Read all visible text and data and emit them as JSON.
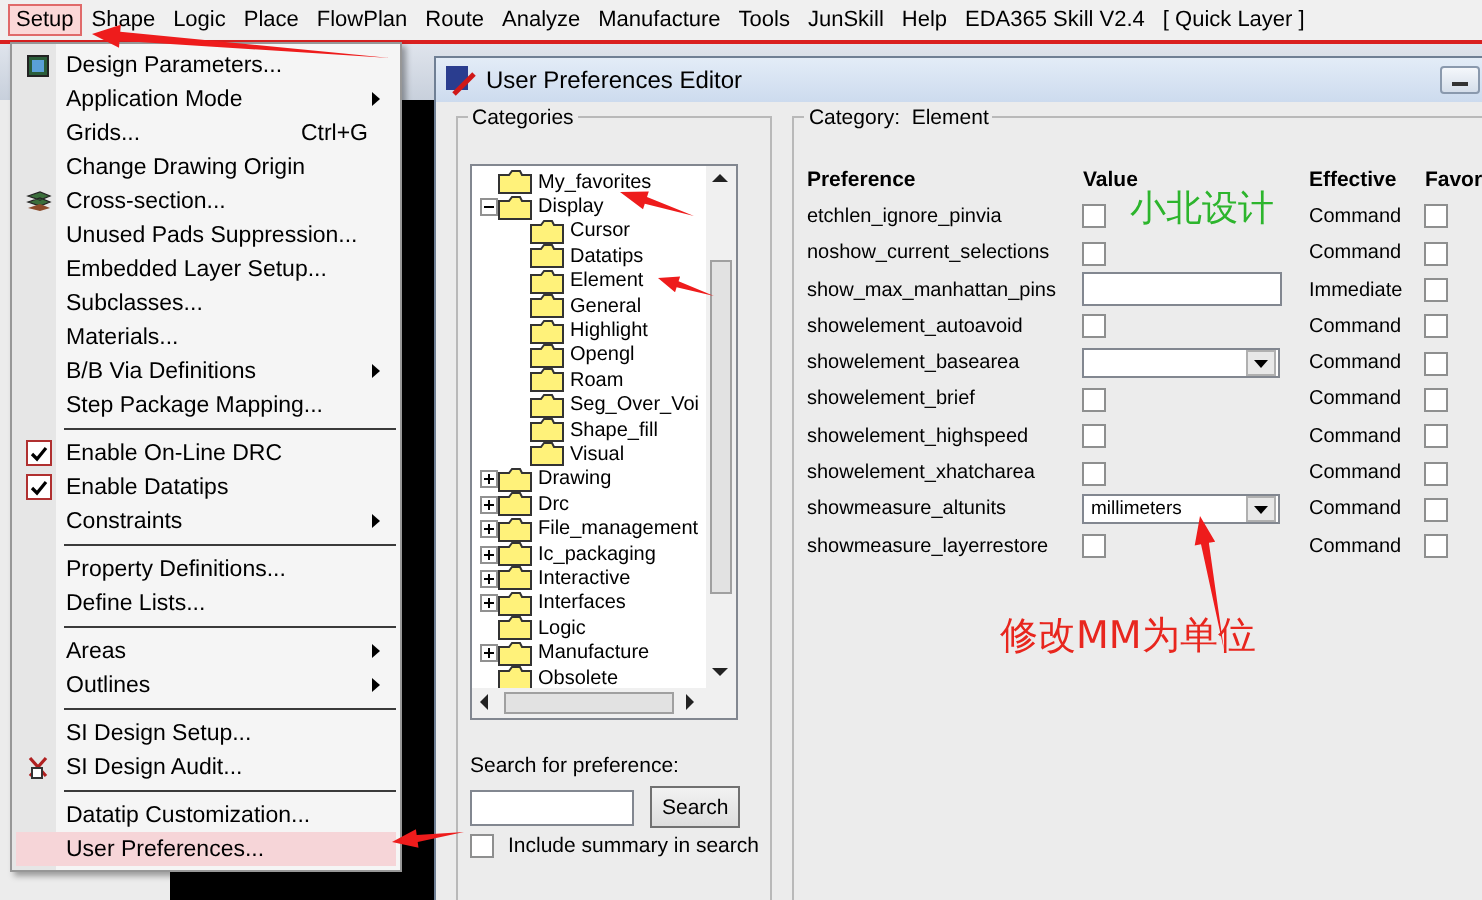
{
  "menu_bar": [
    {
      "label": "Setup",
      "selected": true
    },
    {
      "label": "Shape",
      "selected": false
    },
    {
      "label": "Logic",
      "selected": false
    },
    {
      "label": "Place",
      "selected": false
    },
    {
      "label": "FlowPlan",
      "selected": false
    },
    {
      "label": "Route",
      "selected": false
    },
    {
      "label": "Analyze",
      "selected": false
    },
    {
      "label": "Manufacture",
      "selected": false
    },
    {
      "label": "Tools",
      "selected": false
    },
    {
      "label": "JunSkill",
      "selected": false
    },
    {
      "label": "Help",
      "selected": false
    },
    {
      "label": "EDA365 Skill V2.4",
      "selected": false
    },
    {
      "label": "[ Quick Layer ]",
      "selected": false
    }
  ],
  "setup_menu": [
    {
      "kind": "item",
      "label": "Design Parameters...",
      "selected": false
    },
    {
      "kind": "item",
      "label": "Application Mode",
      "submenu": true,
      "selected": false
    },
    {
      "kind": "item",
      "label": "Grids...",
      "shortcut": "Ctrl+G",
      "selected": false
    },
    {
      "kind": "item",
      "label": "Change Drawing Origin",
      "selected": false
    },
    {
      "kind": "item",
      "label": "Cross-section...",
      "selected": false
    },
    {
      "kind": "item",
      "label": "Unused Pads Suppression...",
      "selected": false
    },
    {
      "kind": "item",
      "label": "Embedded Layer Setup...",
      "selected": false
    },
    {
      "kind": "item",
      "label": "Subclasses...",
      "selected": false
    },
    {
      "kind": "item",
      "label": "Materials...",
      "selected": false
    },
    {
      "kind": "item",
      "label": "B/B Via Definitions",
      "submenu": true,
      "selected": false
    },
    {
      "kind": "item",
      "label": "Step Package Mapping...",
      "selected": false
    },
    {
      "kind": "separator"
    },
    {
      "kind": "check",
      "label": "Enable On-Line DRC",
      "checked": true,
      "selected": false
    },
    {
      "kind": "check",
      "label": "Enable Datatips",
      "checked": true,
      "selected": false
    },
    {
      "kind": "item",
      "label": "Constraints",
      "submenu": true,
      "selected": false
    },
    {
      "kind": "separator"
    },
    {
      "kind": "item",
      "label": "Property Definitions...",
      "selected": false
    },
    {
      "kind": "item",
      "label": "Define Lists...",
      "selected": false
    },
    {
      "kind": "separator"
    },
    {
      "kind": "item",
      "label": "Areas",
      "submenu": true,
      "selected": false
    },
    {
      "kind": "item",
      "label": "Outlines",
      "submenu": true,
      "selected": false
    },
    {
      "kind": "separator"
    },
    {
      "kind": "item",
      "label": "SI Design Setup...",
      "selected": false
    },
    {
      "kind": "item",
      "label": "SI Design Audit...",
      "selected": false
    },
    {
      "kind": "separator"
    },
    {
      "kind": "item",
      "label": "Datatip Customization...",
      "selected": false
    },
    {
      "kind": "item",
      "label": "User Preferences...",
      "selected": true
    }
  ],
  "dialog": {
    "title": "User Preferences Editor",
    "categories": {
      "title": "Categories",
      "tree": [
        {
          "label": "My_favorites"
        },
        {
          "label": "Display",
          "expanded": true,
          "children": [
            {
              "label": "Cursor"
            },
            {
              "label": "Datatips"
            },
            {
              "label": "Element"
            },
            {
              "label": "General"
            },
            {
              "label": "Highlight"
            },
            {
              "label": "Opengl"
            },
            {
              "label": "Roam"
            },
            {
              "label": "Seg_Over_Voi"
            },
            {
              "label": "Shape_fill"
            },
            {
              "label": "Visual"
            }
          ]
        },
        {
          "label": "Drawing",
          "expanded": false
        },
        {
          "label": "Drc",
          "expanded": false
        },
        {
          "label": "File_management",
          "expanded": false
        },
        {
          "label": "Ic_packaging",
          "expanded": false
        },
        {
          "label": "Interactive",
          "expanded": false
        },
        {
          "label": "Interfaces",
          "expanded": false
        },
        {
          "label": "Logic"
        },
        {
          "label": "Manufacture",
          "expanded": false
        },
        {
          "label": "Obsolete"
        }
      ],
      "search_label": "Search for preference:",
      "search_button": "Search",
      "include_summary": {
        "label": "Include summary in search",
        "checked": false
      }
    },
    "preferences": {
      "category_label": "Category:",
      "category": "Element",
      "columns": [
        "Preference",
        "Value",
        "Effective",
        "Favor"
      ],
      "rows": [
        {
          "name": "etchlen_ignore_pinvia",
          "kind": "checkbox",
          "checked": false,
          "effective": "Command",
          "favorite": false
        },
        {
          "name": "noshow_current_selections",
          "kind": "checkbox",
          "checked": false,
          "effective": "Command",
          "favorite": false
        },
        {
          "name": "show_max_manhattan_pins",
          "kind": "text",
          "effective": "Immediate",
          "favorite": false
        },
        {
          "name": "showelement_autoavoid",
          "kind": "checkbox",
          "checked": false,
          "effective": "Command",
          "favorite": false
        },
        {
          "name": "showelement_basearea",
          "kind": "dropdown",
          "effective": "Command",
          "favorite": false
        },
        {
          "name": "showelement_brief",
          "kind": "checkbox",
          "checked": false,
          "effective": "Command",
          "favorite": false
        },
        {
          "name": "showelement_highspeed",
          "kind": "checkbox",
          "checked": false,
          "effective": "Command",
          "favorite": false
        },
        {
          "name": "showelement_xhatcharea",
          "kind": "checkbox",
          "checked": false,
          "effective": "Command",
          "favorite": false
        },
        {
          "name": "showmeasure_altunits",
          "kind": "dropdown",
          "value": "millimeters",
          "effective": "Command",
          "favorite": false
        },
        {
          "name": "showmeasure_layerrestore",
          "kind": "checkbox",
          "checked": false,
          "effective": "Command",
          "favorite": false
        }
      ]
    }
  },
  "annotations": [
    {
      "text": "小北设计",
      "color": "#2db52d"
    },
    {
      "text": "修改MM为单位",
      "color": "#e8261e"
    }
  ]
}
